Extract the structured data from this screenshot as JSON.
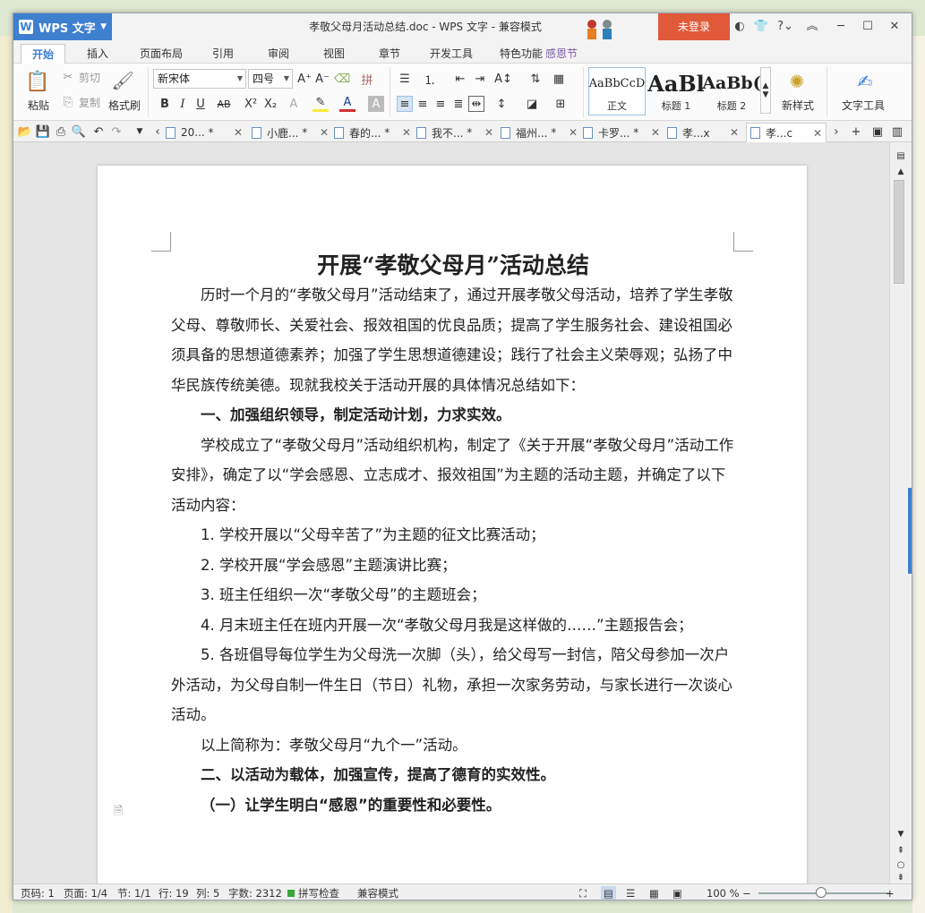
{
  "window": {
    "app_name": "WPS 文字",
    "title": "孝敬父母月活动总结.doc - WPS 文字 - 兼容模式",
    "login_label": "未登录"
  },
  "menu": {
    "tabs": [
      "开始",
      "插入",
      "页面布局",
      "引用",
      "审阅",
      "视图",
      "章节",
      "开发工具",
      "特色功能"
    ],
    "promo_text": "感恩节",
    "active_tab": "开始"
  },
  "ribbon": {
    "paste": "粘贴",
    "cut": "剪切",
    "copy": "复制",
    "format_painter": "格式刷",
    "font_name": "新宋体",
    "font_size": "四号",
    "styles": [
      {
        "preview": "AaBbCcD",
        "name": "正文"
      },
      {
        "preview": "AaBl",
        "name": "标题 1"
      },
      {
        "preview": "AaBb(",
        "name": "标题 2"
      }
    ],
    "new_style": "新样式",
    "text_tools": "文字工具"
  },
  "doc_tabs": [
    {
      "label": "20...",
      "modified": true
    },
    {
      "label": "小鹿...",
      "modified": true
    },
    {
      "label": "春的...",
      "modified": true
    },
    {
      "label": "我不...",
      "modified": true
    },
    {
      "label": "福州...",
      "modified": true
    },
    {
      "label": "卡罗...",
      "modified": true
    },
    {
      "label": "孝...x",
      "modified": false
    },
    {
      "label": "孝...c",
      "modified": false
    }
  ],
  "document": {
    "title": "开展“孝敬父母月”活动总结",
    "paragraphs": [
      {
        "text": "历时一个月的“孝敬父母月”活动结束了，通过开展孝敬父母活动，培养了学生孝敬父母、尊敬师长、关爱社会、报效祖国的优良品质；提高了学生服务社会、建设祖国必须具备的思想道德素养；加强了学生思想道德建设；践行了社会主义荣辱观；弘扬了中华民族传统美德。现就我校关于活动开展的具体情况总结如下：",
        "bold": false
      },
      {
        "text": "一、加强组织领导，制定活动计划，力求实效。",
        "bold": true
      },
      {
        "text": "学校成立了“孝敬父母月”活动组织机构，制定了《关于开展“孝敬父母月”活动工作安排》，确定了以“学会感恩、立志成才、报效祖国”为主题的活动主题，并确定了以下活动内容：",
        "bold": false
      },
      {
        "text": "1. 学校开展以“父母辛苦了”为主题的征文比赛活动；",
        "bold": false
      },
      {
        "text": "2. 学校开展“学会感恩”主题演讲比赛；",
        "bold": false
      },
      {
        "text": "3. 班主任组织一次“孝敬父母”的主题班会；",
        "bold": false
      },
      {
        "text": "4. 月末班主任在班内开展一次“孝敬父母月我是这样做的……”主题报告会；",
        "bold": false
      },
      {
        "text": "5. 各班倡导每位学生为父母洗一次脚（头），给父母写一封信，陪父母参加一次户外活动，为父母自制一件生日（节日）礼物，承担一次家务劳动，与家长进行一次谈心活动。",
        "bold": false
      },
      {
        "text": "以上简称为：孝敬父母月“九个一”活动。",
        "bold": false
      },
      {
        "text": "二、以活动为载体，加强宣传，提高了德育的实效性。",
        "bold": true
      },
      {
        "text": "（一）让学生明白“感恩”的重要性和必要性。",
        "bold": true
      }
    ]
  },
  "status": {
    "page_no": "页码: 1",
    "pages": "页面: 1/4",
    "section": "节: 1/1",
    "row": "行: 19",
    "col": "列: 5",
    "words": "字数: 2312",
    "spell": "拼写检查",
    "mode": "兼容模式",
    "zoom": "100 %"
  }
}
